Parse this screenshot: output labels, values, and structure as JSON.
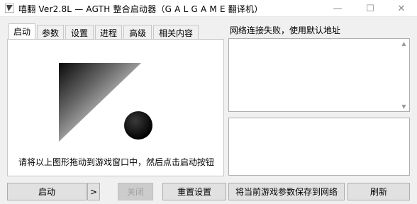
{
  "window": {
    "title": "嘻翻 Ver2.8L — AGTH 整合启动器（G A L G A M E 翻译机）",
    "controls": {
      "minimize": "—",
      "maximize": "☐",
      "close": "✕"
    }
  },
  "tabs": [
    {
      "label": "启动",
      "active": true
    },
    {
      "label": "参数",
      "active": false
    },
    {
      "label": "设置",
      "active": false
    },
    {
      "label": "进程",
      "active": false
    },
    {
      "label": "高级",
      "active": false
    },
    {
      "label": "相关内容",
      "active": false
    }
  ],
  "start_panel": {
    "hint": "请将以上图形拖动到游戏窗口中，然后点击启动按钮"
  },
  "right_panel": {
    "status": "网络连接失败，使用默认地址"
  },
  "buttons": {
    "start": "启动",
    "more": ">",
    "close": "关闭",
    "reset": "重置设置",
    "save_to_network": "将当前游戏参数保存到网络",
    "refresh": "刷新"
  },
  "icons": {
    "app": "app-icon",
    "drag_target": "drag-target-shape-icon"
  }
}
